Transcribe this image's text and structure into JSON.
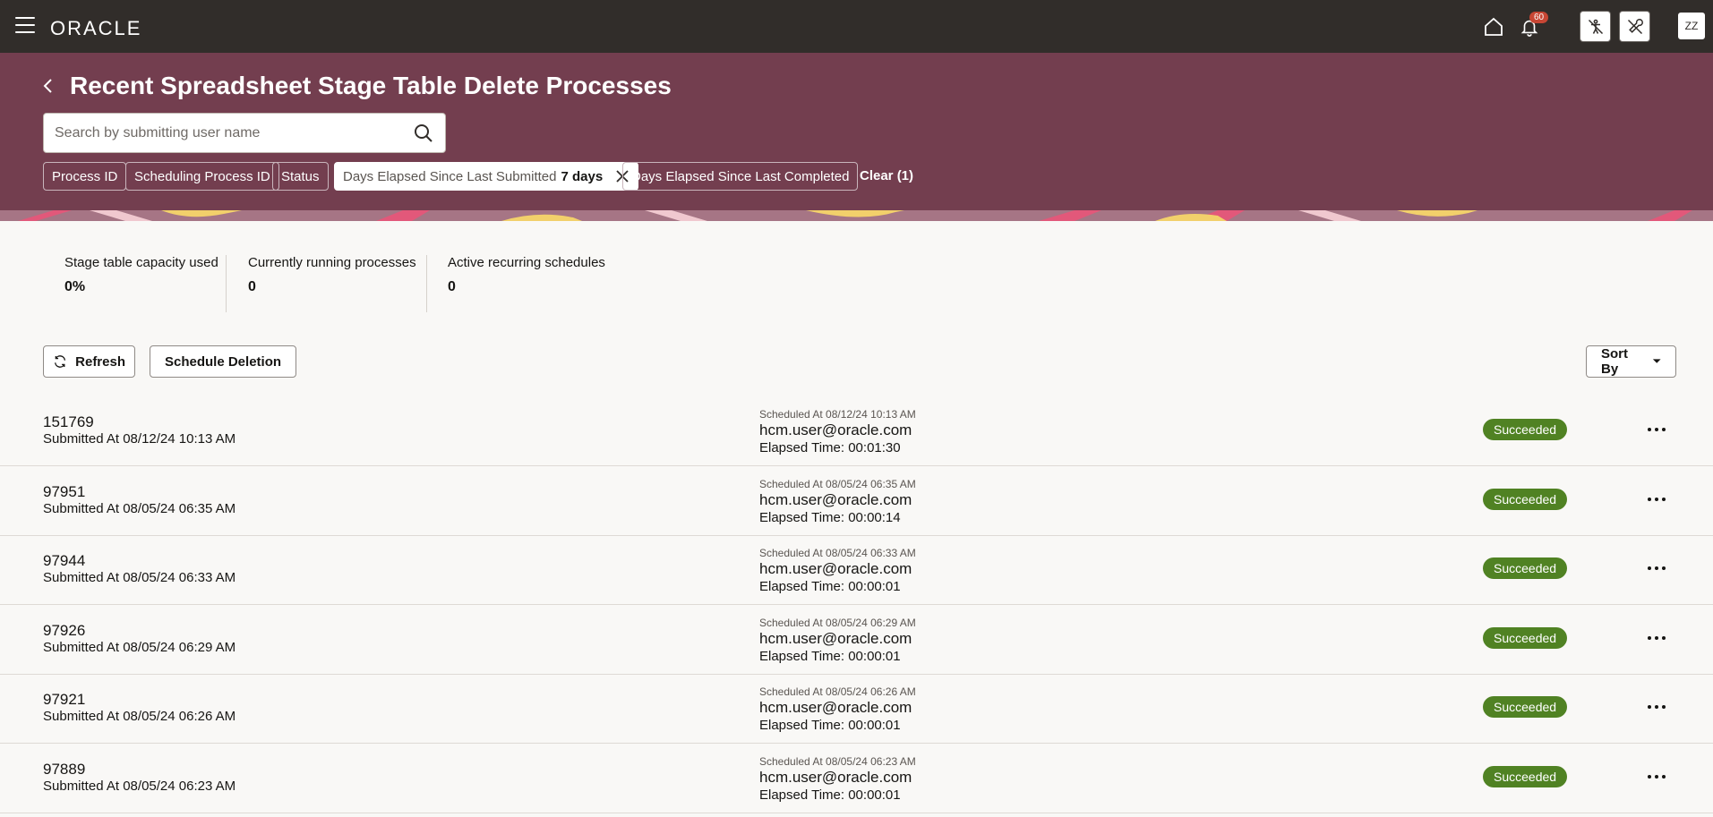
{
  "topbar": {
    "logo": "ORACLE",
    "notification_count": "60",
    "user_initials": "ZZ"
  },
  "header": {
    "title": "Recent Spreadsheet Stage Table Delete Processes",
    "search_placeholder": "Search by submitting user name",
    "filters": {
      "process_id": "Process ID",
      "scheduling_process_id": "Scheduling Process ID",
      "status": "Status",
      "days_submitted_label": "Days Elapsed Since Last Submitted",
      "days_submitted_value": "7 days",
      "days_completed": "Days Elapsed Since Last Completed",
      "clear": "Clear (1)"
    }
  },
  "metrics": [
    {
      "label": "Stage table capacity used",
      "value": "0%"
    },
    {
      "label": "Currently running processes",
      "value": "0"
    },
    {
      "label": "Active recurring schedules",
      "value": "0"
    }
  ],
  "toolbar": {
    "refresh": "Refresh",
    "schedule_deletion": "Schedule Deletion",
    "sort_by": "Sort By"
  },
  "rows": [
    {
      "id": "151769",
      "submitted": "Submitted At 08/12/24 10:13 AM",
      "scheduled": "Scheduled At 08/12/24 10:13 AM",
      "user": "hcm.user@oracle.com",
      "elapsed": "Elapsed Time: 00:01:30",
      "status": "Succeeded"
    },
    {
      "id": "97951",
      "submitted": "Submitted At 08/05/24 06:35 AM",
      "scheduled": "Scheduled At 08/05/24 06:35 AM",
      "user": "hcm.user@oracle.com",
      "elapsed": "Elapsed Time: 00:00:14",
      "status": "Succeeded"
    },
    {
      "id": "97944",
      "submitted": "Submitted At 08/05/24 06:33 AM",
      "scheduled": "Scheduled At 08/05/24 06:33 AM",
      "user": "hcm.user@oracle.com",
      "elapsed": "Elapsed Time: 00:00:01",
      "status": "Succeeded"
    },
    {
      "id": "97926",
      "submitted": "Submitted At 08/05/24 06:29 AM",
      "scheduled": "Scheduled At 08/05/24 06:29 AM",
      "user": "hcm.user@oracle.com",
      "elapsed": "Elapsed Time: 00:00:01",
      "status": "Succeeded"
    },
    {
      "id": "97921",
      "submitted": "Submitted At 08/05/24 06:26 AM",
      "scheduled": "Scheduled At 08/05/24 06:26 AM",
      "user": "hcm.user@oracle.com",
      "elapsed": "Elapsed Time: 00:00:01",
      "status": "Succeeded"
    },
    {
      "id": "97889",
      "submitted": "Submitted At 08/05/24 06:23 AM",
      "scheduled": "Scheduled At 08/05/24 06:23 AM",
      "user": "hcm.user@oracle.com",
      "elapsed": "Elapsed Time: 00:00:01",
      "status": "Succeeded"
    }
  ]
}
